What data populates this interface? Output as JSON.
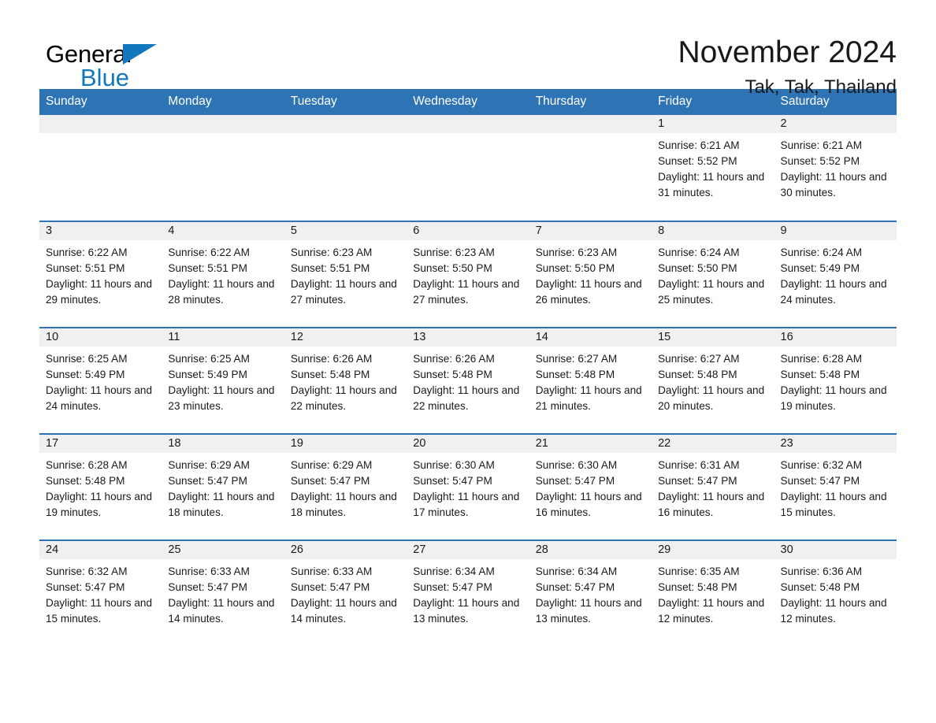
{
  "brand": {
    "name_part1": "General",
    "name_part2": "Blue",
    "triangle_color": "#1277bc"
  },
  "header": {
    "title": "November 2024",
    "subtitle": "Tak, Tak, Thailand",
    "accent_color": "#2e74b5"
  },
  "weekdays": [
    "Sunday",
    "Monday",
    "Tuesday",
    "Wednesday",
    "Thursday",
    "Friday",
    "Saturday"
  ],
  "labels": {
    "sunrise_prefix": "Sunrise:",
    "sunset_prefix": "Sunset:",
    "daylight_prefix": "Daylight:"
  },
  "weeks": [
    [
      {
        "blank": true
      },
      {
        "blank": true
      },
      {
        "blank": true
      },
      {
        "blank": true
      },
      {
        "blank": true
      },
      {
        "day": "1",
        "sunrise": "Sunrise: 6:21 AM",
        "sunset": "Sunset: 5:52 PM",
        "daylight": "Daylight: 11 hours and 31 minutes."
      },
      {
        "day": "2",
        "sunrise": "Sunrise: 6:21 AM",
        "sunset": "Sunset: 5:52 PM",
        "daylight": "Daylight: 11 hours and 30 minutes."
      }
    ],
    [
      {
        "day": "3",
        "sunrise": "Sunrise: 6:22 AM",
        "sunset": "Sunset: 5:51 PM",
        "daylight": "Daylight: 11 hours and 29 minutes."
      },
      {
        "day": "4",
        "sunrise": "Sunrise: 6:22 AM",
        "sunset": "Sunset: 5:51 PM",
        "daylight": "Daylight: 11 hours and 28 minutes."
      },
      {
        "day": "5",
        "sunrise": "Sunrise: 6:23 AM",
        "sunset": "Sunset: 5:51 PM",
        "daylight": "Daylight: 11 hours and 27 minutes."
      },
      {
        "day": "6",
        "sunrise": "Sunrise: 6:23 AM",
        "sunset": "Sunset: 5:50 PM",
        "daylight": "Daylight: 11 hours and 27 minutes."
      },
      {
        "day": "7",
        "sunrise": "Sunrise: 6:23 AM",
        "sunset": "Sunset: 5:50 PM",
        "daylight": "Daylight: 11 hours and 26 minutes."
      },
      {
        "day": "8",
        "sunrise": "Sunrise: 6:24 AM",
        "sunset": "Sunset: 5:50 PM",
        "daylight": "Daylight: 11 hours and 25 minutes."
      },
      {
        "day": "9",
        "sunrise": "Sunrise: 6:24 AM",
        "sunset": "Sunset: 5:49 PM",
        "daylight": "Daylight: 11 hours and 24 minutes."
      }
    ],
    [
      {
        "day": "10",
        "sunrise": "Sunrise: 6:25 AM",
        "sunset": "Sunset: 5:49 PM",
        "daylight": "Daylight: 11 hours and 24 minutes."
      },
      {
        "day": "11",
        "sunrise": "Sunrise: 6:25 AM",
        "sunset": "Sunset: 5:49 PM",
        "daylight": "Daylight: 11 hours and 23 minutes."
      },
      {
        "day": "12",
        "sunrise": "Sunrise: 6:26 AM",
        "sunset": "Sunset: 5:48 PM",
        "daylight": "Daylight: 11 hours and 22 minutes."
      },
      {
        "day": "13",
        "sunrise": "Sunrise: 6:26 AM",
        "sunset": "Sunset: 5:48 PM",
        "daylight": "Daylight: 11 hours and 22 minutes."
      },
      {
        "day": "14",
        "sunrise": "Sunrise: 6:27 AM",
        "sunset": "Sunset: 5:48 PM",
        "daylight": "Daylight: 11 hours and 21 minutes."
      },
      {
        "day": "15",
        "sunrise": "Sunrise: 6:27 AM",
        "sunset": "Sunset: 5:48 PM",
        "daylight": "Daylight: 11 hours and 20 minutes."
      },
      {
        "day": "16",
        "sunrise": "Sunrise: 6:28 AM",
        "sunset": "Sunset: 5:48 PM",
        "daylight": "Daylight: 11 hours and 19 minutes."
      }
    ],
    [
      {
        "day": "17",
        "sunrise": "Sunrise: 6:28 AM",
        "sunset": "Sunset: 5:48 PM",
        "daylight": "Daylight: 11 hours and 19 minutes."
      },
      {
        "day": "18",
        "sunrise": "Sunrise: 6:29 AM",
        "sunset": "Sunset: 5:47 PM",
        "daylight": "Daylight: 11 hours and 18 minutes."
      },
      {
        "day": "19",
        "sunrise": "Sunrise: 6:29 AM",
        "sunset": "Sunset: 5:47 PM",
        "daylight": "Daylight: 11 hours and 18 minutes."
      },
      {
        "day": "20",
        "sunrise": "Sunrise: 6:30 AM",
        "sunset": "Sunset: 5:47 PM",
        "daylight": "Daylight: 11 hours and 17 minutes."
      },
      {
        "day": "21",
        "sunrise": "Sunrise: 6:30 AM",
        "sunset": "Sunset: 5:47 PM",
        "daylight": "Daylight: 11 hours and 16 minutes."
      },
      {
        "day": "22",
        "sunrise": "Sunrise: 6:31 AM",
        "sunset": "Sunset: 5:47 PM",
        "daylight": "Daylight: 11 hours and 16 minutes."
      },
      {
        "day": "23",
        "sunrise": "Sunrise: 6:32 AM",
        "sunset": "Sunset: 5:47 PM",
        "daylight": "Daylight: 11 hours and 15 minutes."
      }
    ],
    [
      {
        "day": "24",
        "sunrise": "Sunrise: 6:32 AM",
        "sunset": "Sunset: 5:47 PM",
        "daylight": "Daylight: 11 hours and 15 minutes."
      },
      {
        "day": "25",
        "sunrise": "Sunrise: 6:33 AM",
        "sunset": "Sunset: 5:47 PM",
        "daylight": "Daylight: 11 hours and 14 minutes."
      },
      {
        "day": "26",
        "sunrise": "Sunrise: 6:33 AM",
        "sunset": "Sunset: 5:47 PM",
        "daylight": "Daylight: 11 hours and 14 minutes."
      },
      {
        "day": "27",
        "sunrise": "Sunrise: 6:34 AM",
        "sunset": "Sunset: 5:47 PM",
        "daylight": "Daylight: 11 hours and 13 minutes."
      },
      {
        "day": "28",
        "sunrise": "Sunrise: 6:34 AM",
        "sunset": "Sunset: 5:47 PM",
        "daylight": "Daylight: 11 hours and 13 minutes."
      },
      {
        "day": "29",
        "sunrise": "Sunrise: 6:35 AM",
        "sunset": "Sunset: 5:48 PM",
        "daylight": "Daylight: 11 hours and 12 minutes."
      },
      {
        "day": "30",
        "sunrise": "Sunrise: 6:36 AM",
        "sunset": "Sunset: 5:48 PM",
        "daylight": "Daylight: 11 hours and 12 minutes."
      }
    ]
  ]
}
